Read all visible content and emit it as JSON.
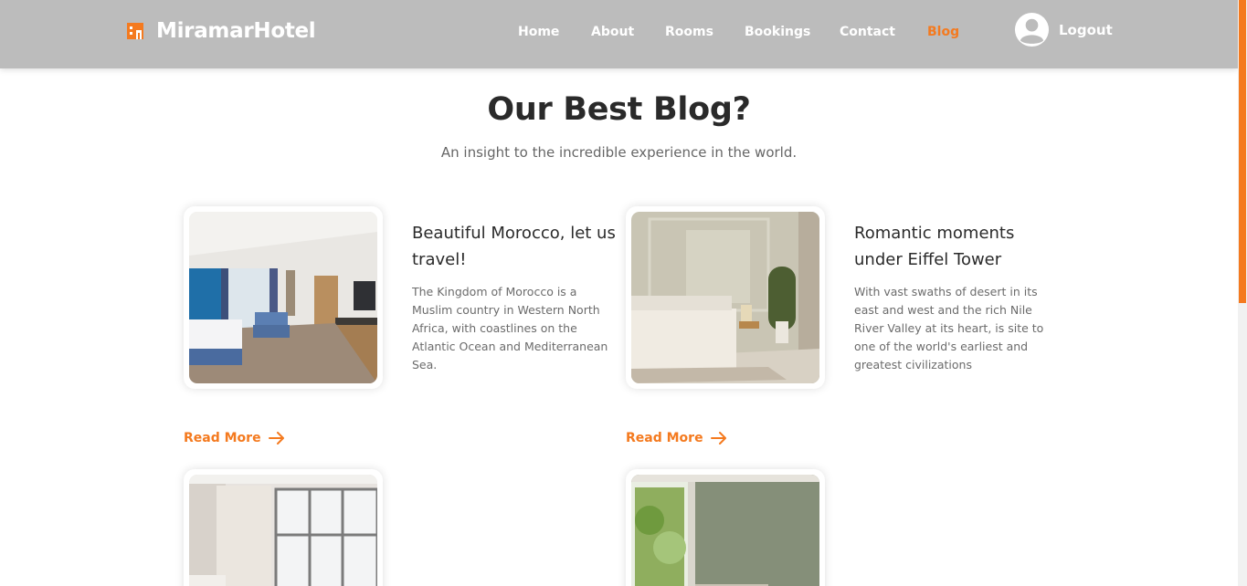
{
  "brand": {
    "name": "MiramarHotel",
    "icon": "hotel-icon"
  },
  "nav": {
    "items": [
      {
        "label": "Home"
      },
      {
        "label": "About"
      },
      {
        "label": "Rooms"
      },
      {
        "label": "Bookings"
      },
      {
        "label": "Contact"
      },
      {
        "label": "Blog",
        "active": true
      }
    ],
    "logout_label": "Logout",
    "avatar_icon": "user-avatar-icon"
  },
  "colors": {
    "accent": "#f47a1f",
    "navbar": "#bcbcbc"
  },
  "hero": {
    "title": "Our Best Blog?",
    "subtitle": "An insight to the incredible experience in the world."
  },
  "posts": [
    {
      "title": "Beautiful Morocco, let us travel!",
      "text": "The Kingdom of Morocco is a Muslim country in Western North Africa, with coastlines on the Atlantic Ocean and Mediterranean Sea.",
      "read_more": "Read More"
    },
    {
      "title": "Romantic moments under Eiffel Tower",
      "text": "With vast swaths of desert in its east and west and the rich Nile River Valley at its heart, is site to one of the world's earliest and greatest civilizations",
      "read_more": "Read More"
    }
  ]
}
